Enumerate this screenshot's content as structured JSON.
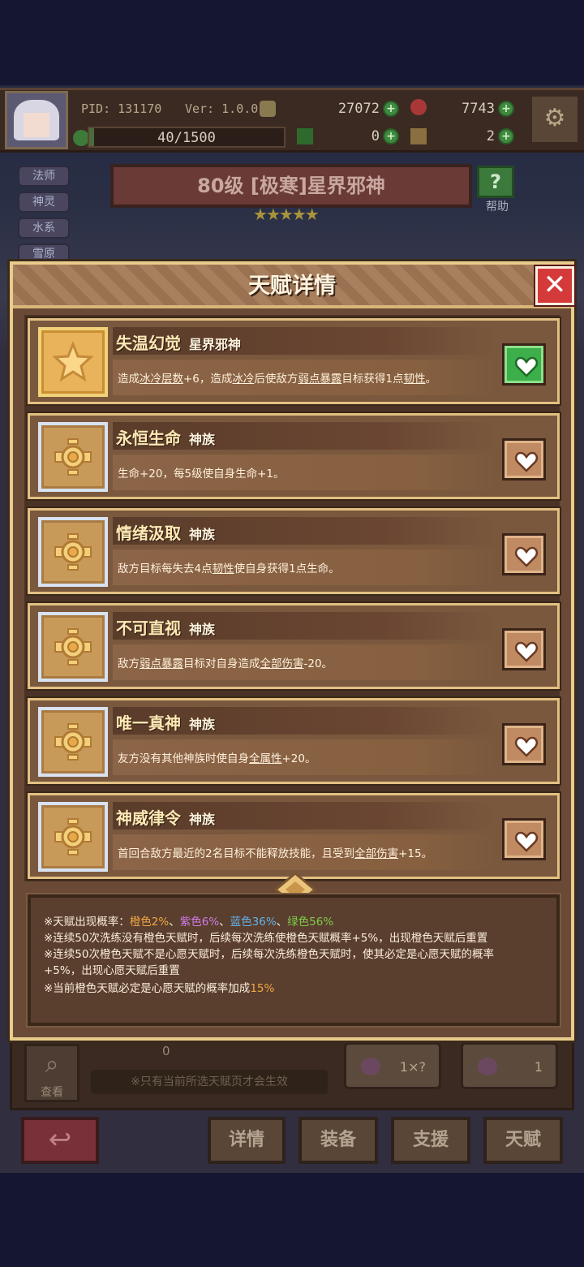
{
  "topbar": {
    "pid": "PID: 131170",
    "version": "Ver: 1.0.0.5",
    "gold": "27072",
    "gems": "7743",
    "exp": "40/1500",
    "exp_fraction": 0.027,
    "clover": "0",
    "keys": "2"
  },
  "side_tabs": [
    "法师",
    "神灵",
    "水系",
    "雪原"
  ],
  "hero": {
    "title": "80级 [极寒]星界邪神",
    "stars": 5,
    "help_label": "帮助"
  },
  "modal": {
    "title": "天赋详情",
    "talents": [
      {
        "name": "失温幻觉",
        "tag": "星界邪神",
        "gold": true,
        "wish": true,
        "desc": [
          "造成",
          "冰冷层数",
          "+6，造成",
          "冰冷",
          "后使敌方",
          "弱点暴露",
          "目标获得1点",
          "韧性",
          "。"
        ]
      },
      {
        "name": "永恒生命",
        "tag": "神族",
        "gold": false,
        "wish": false,
        "desc": [
          "生命+20，每5级使自身生命+1。"
        ]
      },
      {
        "name": "情绪汲取",
        "tag": "神族",
        "gold": false,
        "wish": false,
        "desc": [
          "敌方目标每失去4点",
          "韧性",
          "使自身获得1点生命。"
        ]
      },
      {
        "name": "不可直视",
        "tag": "神族",
        "gold": false,
        "wish": false,
        "desc": [
          "敌方",
          "弱点暴露",
          "目标对自身造成",
          "全部伤害",
          "-20。"
        ]
      },
      {
        "name": "唯一真神",
        "tag": "神族",
        "gold": false,
        "wish": false,
        "desc": [
          "友方没有其他神族时使自身",
          "全属性",
          "+20。"
        ]
      },
      {
        "name": "神威律令",
        "tag": "神族",
        "gold": false,
        "wish": false,
        "desc": [
          "首回合敌方最近的2名目标不能释放技能，且受到",
          "全部伤害",
          "+15。"
        ]
      }
    ],
    "info": {
      "prob_label": "※天赋出现概率：",
      "orange": "橙色2%",
      "purple": "紫色6%",
      "blue": "蓝色36%",
      "green": "绿色56%",
      "sep": "、",
      "line2": "※连续50次洗练没有橙色天赋时，后续每次洗练使橙色天赋概率+5%，出现橙色天赋后重置",
      "line3a": "※连续50次橙色天赋不是心愿天赋时，后续每次洗练橙色天赋时，使其必定是心愿天赋的概率",
      "line3b": "+5%，出现心愿天赋后重置",
      "line4a": "※当前橙色天赋必定是心愿天赋的概率加成",
      "line4b": "15%"
    }
  },
  "lower": {
    "search_label": "查看",
    "count": "0",
    "note": "※只有当前所选天赋页才会生效",
    "auto_value": "1×?",
    "reroll_value": "1"
  },
  "nav": {
    "details": "详情",
    "equip": "装备",
    "support": "支援",
    "talent": "天赋"
  },
  "colors": {
    "accent": "#e9cc8c",
    "wish_on": "#3cae4a",
    "close": "#d43a3a"
  }
}
